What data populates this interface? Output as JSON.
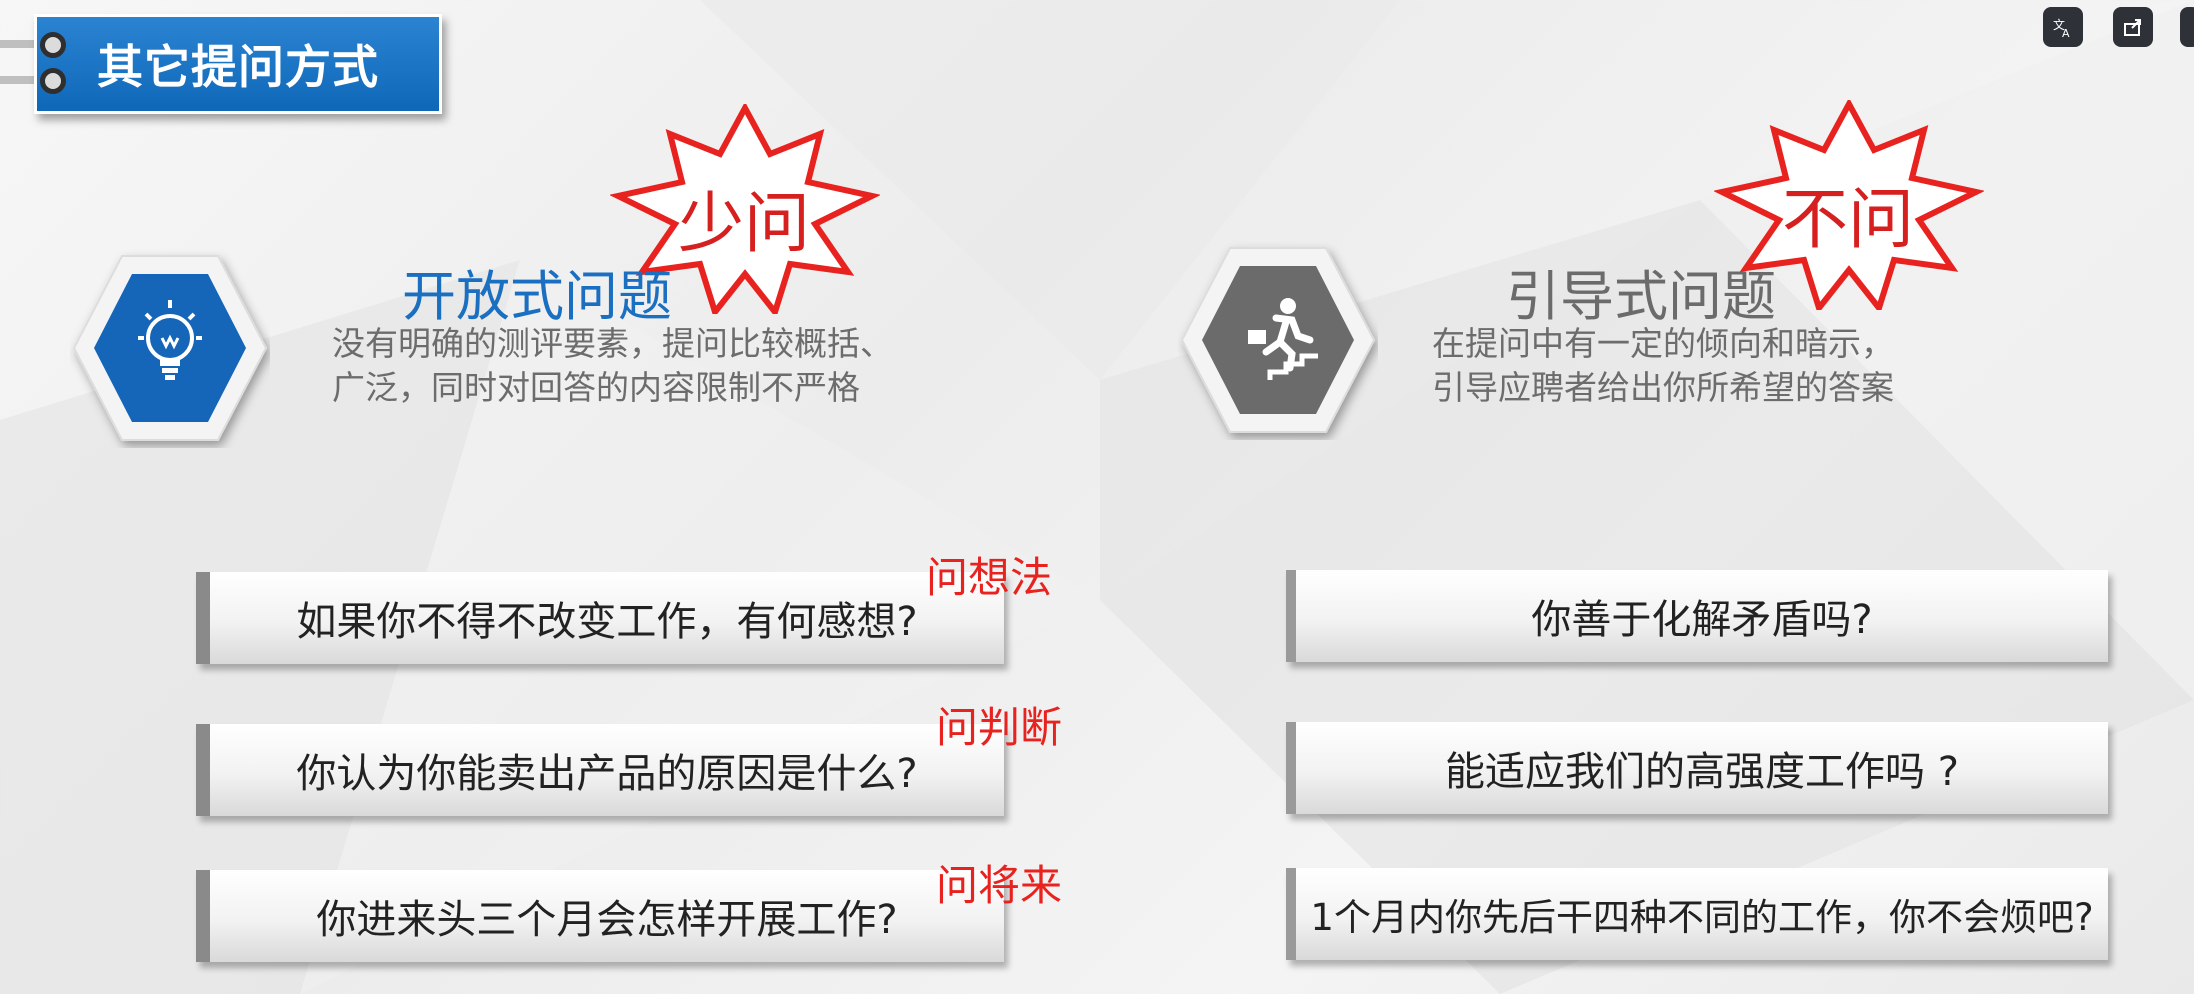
{
  "slide": {
    "title": "其它提问方式",
    "left": {
      "stamp": "少问",
      "heading": "开放式问题",
      "desc_line1": "没有明确的测评要素，提问比较概括、",
      "desc_line2": "广泛，同时对回答的内容限制不严格",
      "icon": "lightbulb-icon",
      "questions": [
        {
          "text": "如果你不得不改变工作，有何感想?",
          "note": "问想法"
        },
        {
          "text": "你认为你能卖出产品的原因是什么?",
          "note": "问判断"
        },
        {
          "text": "你进来头三个月会怎样开展工作?",
          "note": "问将来"
        }
      ]
    },
    "right": {
      "stamp": "不问",
      "heading": "引导式问题",
      "desc_line1": "在提问中有一定的倾向和暗示，",
      "desc_line2": "引导应聘者给出你所希望的答案",
      "icon": "running-upstairs-icon",
      "questions": [
        {
          "text": "你善于化解矛盾吗?"
        },
        {
          "text": "能适应我们的高强度工作吗 ?"
        },
        {
          "text": "1个月内你先后干四种不同的工作，你不会烦吧?"
        }
      ]
    }
  },
  "colors": {
    "brand_blue": "#0f67b8",
    "stamp_red": "#e8231f",
    "heading_blue": "#1a6fc0",
    "hex_gray": "#6b6b6b"
  },
  "toolbar": {
    "icons": [
      "translate-icon",
      "share-icon"
    ]
  }
}
